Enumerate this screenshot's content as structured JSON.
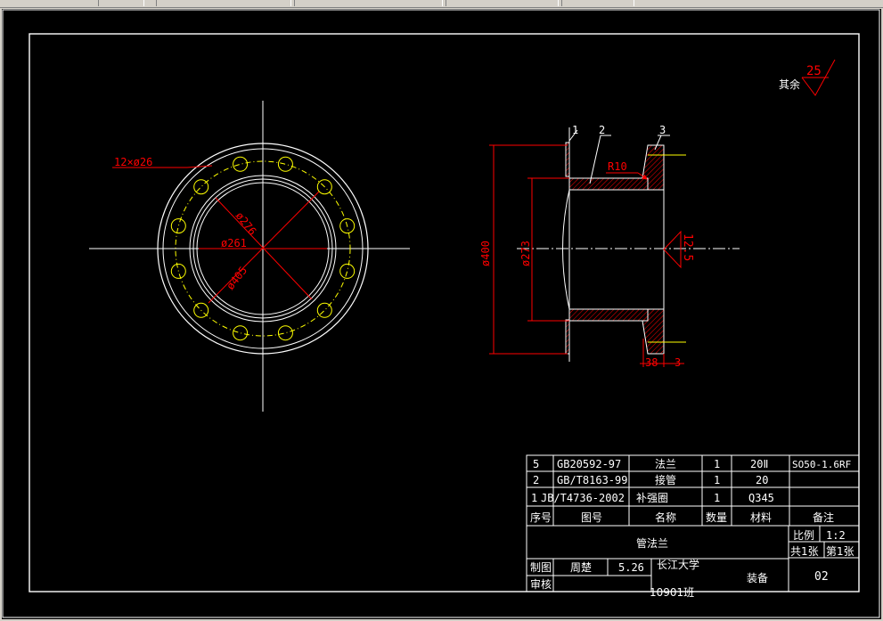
{
  "colors": {
    "background": "#000000",
    "border": "#ffffff",
    "geometry": "#ffffff",
    "bolt_circle": "#ffff00",
    "dimension": "#ff0000",
    "hatch": "#ff0000",
    "centerline": "#ffffff"
  },
  "front_view": {
    "bolt_holes_label": "12×ø26",
    "dim_d276": "ø276",
    "dim_d261": "ø261",
    "dim_d405": "ø405",
    "bolt_hole_count": 12
  },
  "section_view": {
    "balloon_1": "1",
    "balloon_2": "2",
    "balloon_3": "3",
    "radius_label": "R10",
    "dim_d400": "ø400",
    "dim_d273": "ø273",
    "weld_size": "12.5",
    "dim_38": "38",
    "dim_3": "3"
  },
  "roughness": {
    "prefix": "其余",
    "value": "25"
  },
  "bom": {
    "rows": [
      {
        "no": "5",
        "code": "GB20592-97",
        "name": "法兰",
        "qty": "1",
        "material": "20Ⅱ",
        "remark": "SO50-1.6RF"
      },
      {
        "no": "2",
        "code": "GB/T8163-99",
        "name": "接管",
        "qty": "1",
        "material": "20",
        "remark": ""
      },
      {
        "no": "1",
        "code": "JB/T4736-2002",
        "name": "补强圈",
        "qty": "1",
        "material": "Q345",
        "remark": ""
      }
    ],
    "header": {
      "no": "序号",
      "code": "图号",
      "name": "名称",
      "qty": "数量",
      "material": "材料",
      "remark": "备注"
    }
  },
  "title_block": {
    "title": "管法兰",
    "scale_label": "比例",
    "scale_value": "1:2",
    "sheets_total": "共1张",
    "sheet_no": "第1张",
    "drawn_label": "制图",
    "drawn_by": "周楚",
    "drawn_date": "5.26",
    "checked_label": "审核",
    "school": "长江大学",
    "class": "10901班",
    "assembly_label": "装备",
    "drawing_no": "02"
  }
}
